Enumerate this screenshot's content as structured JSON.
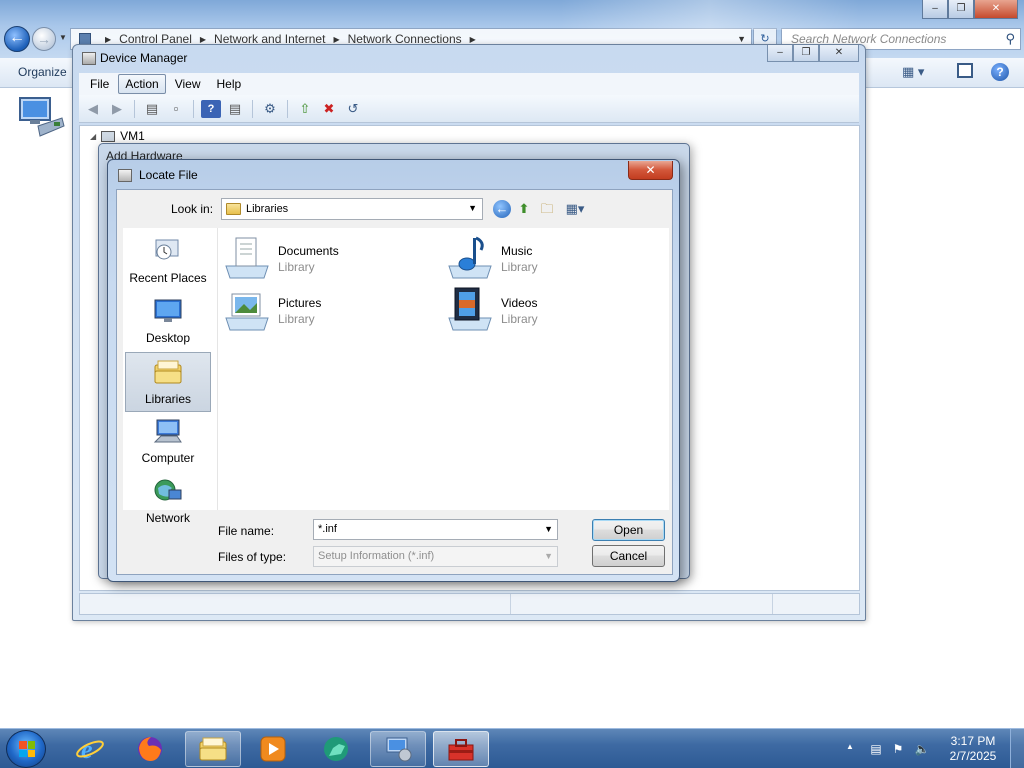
{
  "explorer": {
    "breadcrumb": [
      "Control Panel",
      "Network and Internet",
      "Network Connections"
    ],
    "search_placeholder": "Search Network Connections",
    "organize_label": "Organize"
  },
  "device_manager": {
    "title": "Device Manager",
    "menu": [
      "File",
      "Action",
      "View",
      "Help"
    ],
    "active_menu": "Action",
    "tree_root": "VM1"
  },
  "add_hardware": {
    "title": "Add Hardware"
  },
  "locate_file": {
    "title": "Locate File",
    "close_label": "✕",
    "look_in_label": "Look in:",
    "look_in_value": "Libraries",
    "places": [
      {
        "label": "Recent Places",
        "icon": "recent-places-icon"
      },
      {
        "label": "Desktop",
        "icon": "desktop-icon"
      },
      {
        "label": "Libraries",
        "icon": "libraries-icon"
      },
      {
        "label": "Computer",
        "icon": "computer-icon"
      },
      {
        "label": "Network",
        "icon": "network-icon"
      }
    ],
    "selected_place": "Libraries",
    "items": [
      {
        "name": "Documents",
        "sub": "Library",
        "icon": "documents-library-icon"
      },
      {
        "name": "Music",
        "sub": "Library",
        "icon": "music-library-icon"
      },
      {
        "name": "Pictures",
        "sub": "Library",
        "icon": "pictures-library-icon"
      },
      {
        "name": "Videos",
        "sub": "Library",
        "icon": "videos-library-icon"
      }
    ],
    "file_name_label": "File name:",
    "file_name_value": "*.inf",
    "files_of_type_label": "Files of type:",
    "files_of_type_value": "Setup Information (*.inf)",
    "open_label": "Open",
    "cancel_label": "Cancel"
  },
  "taskbar": {
    "apps": [
      "internet-explorer",
      "firefox",
      "windows-explorer",
      "media-player",
      "unknown-app",
      "device-manager",
      "toolbox"
    ],
    "time": "3:17 PM",
    "date": "2/7/2025"
  },
  "colors": {
    "accent": "#2d5a94",
    "close_red": "#c23d20",
    "selection": "#cbd5e1"
  }
}
